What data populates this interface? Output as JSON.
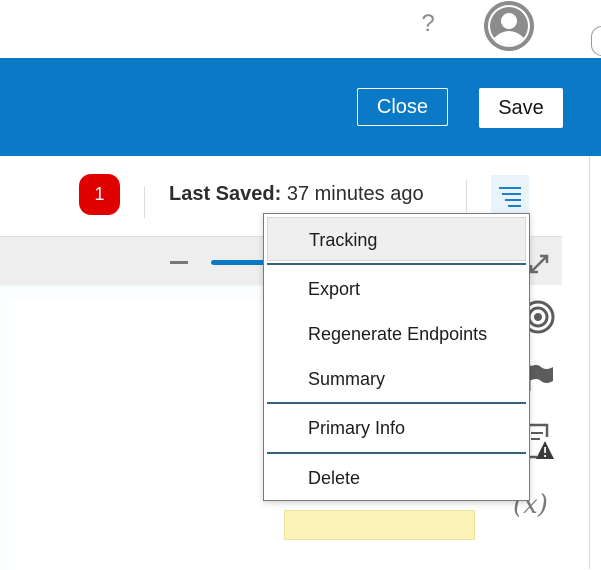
{
  "topbar": {
    "help_icon": "?",
    "avatar_icon": "user-avatar-icon"
  },
  "header": {
    "close_label": "Close",
    "save_label": "Save",
    "background": "#0a7ac6"
  },
  "status": {
    "badge_count": "1",
    "badge_color": "#e00000",
    "last_saved_label": "Last Saved:",
    "last_saved_value": "37 minutes ago",
    "menu_icon": "hamburger-menu-icon"
  },
  "menu": {
    "items": [
      {
        "label": "Tracking"
      },
      {
        "label": "Export"
      },
      {
        "label": "Regenerate Endpoints"
      },
      {
        "label": "Summary"
      },
      {
        "label": "Primary Info"
      },
      {
        "label": "Delete"
      }
    ],
    "hovered_item": "Tracking"
  },
  "side_rail": {
    "icons": [
      "expand-icon",
      "target-icon",
      "flag-icon",
      "warning-list-icon",
      "function-icon"
    ],
    "function_label": "(x)"
  }
}
